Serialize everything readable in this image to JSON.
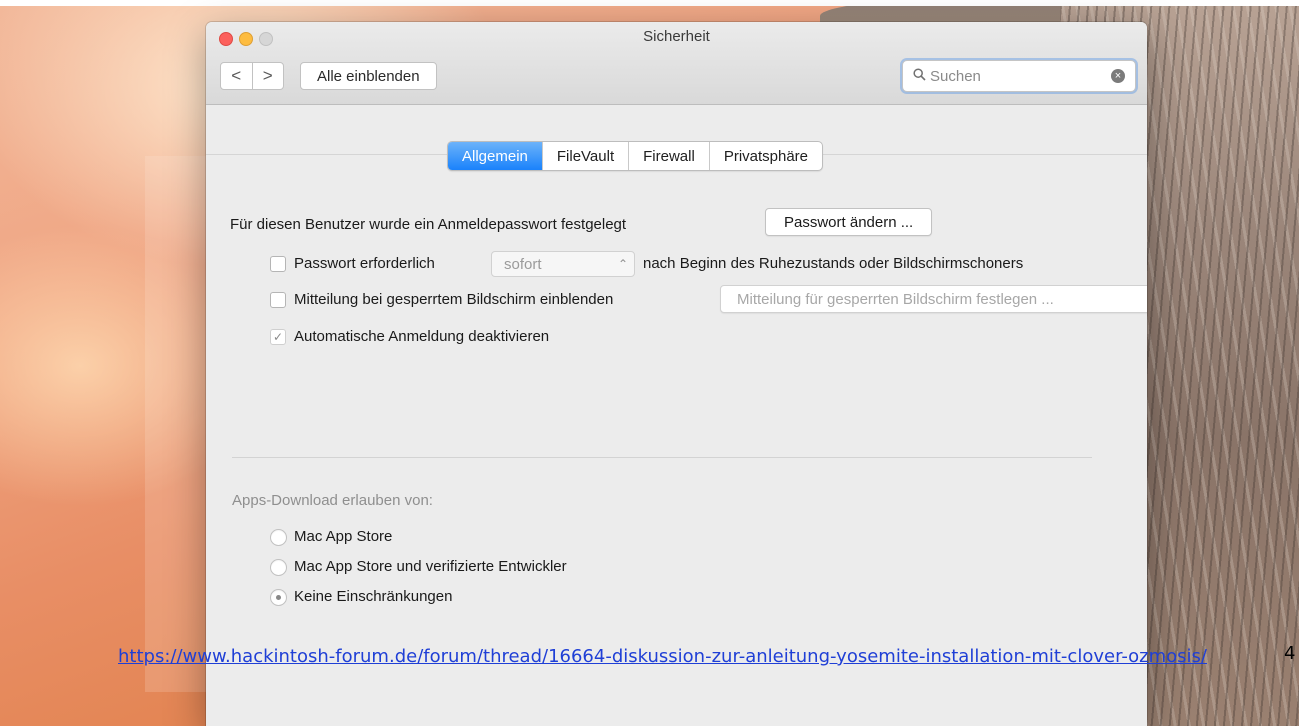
{
  "window": {
    "title": "Sicherheit",
    "nav_back": "<",
    "nav_forward": ">",
    "show_all_label": "Alle einblenden",
    "search_placeholder": "Suchen"
  },
  "tabs": [
    {
      "label": "Allgemein",
      "active": true
    },
    {
      "label": "FileVault",
      "active": false
    },
    {
      "label": "Firewall",
      "active": false
    },
    {
      "label": "Privatsphäre",
      "active": false
    }
  ],
  "general": {
    "password_text": "Für diesen Benutzer wurde ein Anmeldepasswort festgelegt",
    "change_password_button": "Passwort ändern ...",
    "require_password_label": "Passwort erforderlich",
    "require_password_checked": false,
    "delay_select_value": "sofort",
    "after_sleep_text": "nach Beginn des Ruhezustands oder Bildschirmschoners",
    "show_message_label": "Mitteilung bei gesperrtem Bildschirm einblenden",
    "show_message_checked": false,
    "set_message_button": "Mitteilung für gesperrten Bildschirm festlegen ...",
    "disable_autologin_label": "Automatische Anmeldung deaktivieren",
    "disable_autologin_checked": true,
    "check_mark": "✓"
  },
  "downloads": {
    "heading": "Apps-Download erlauben von:",
    "options": [
      {
        "label": "Mac App Store",
        "selected": false
      },
      {
        "label": "Mac App Store und verifizierte Entwickler",
        "selected": false
      },
      {
        "label": "Keine Einschränkungen",
        "selected": true
      }
    ]
  },
  "document": {
    "link_text": "https://www.hackintosh-forum.de/forum/thread/16664-diskussion-zur-anleitung-yosemite-installation-mit-clover-ozmosis/",
    "page_number": "4"
  },
  "colors": {
    "tab_active": "#1a82fb",
    "link": "#1f3fd6",
    "traffic_close": "#fc605c",
    "traffic_minimize": "#fdbc40"
  }
}
